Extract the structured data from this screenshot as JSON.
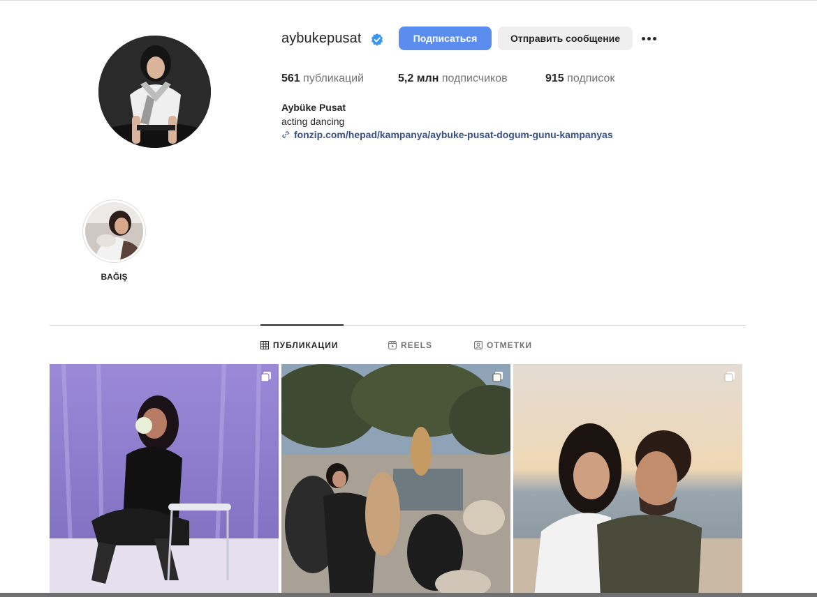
{
  "profile": {
    "username": "aybukepusat",
    "verified_icon": "verified-badge-icon",
    "follow_label": "Подписаться",
    "message_label": "Отправить сообщение",
    "more_icon": "more-options-icon"
  },
  "stats": {
    "posts": {
      "value": "561",
      "label": "публикаций"
    },
    "followers": {
      "value": "5,2 млн",
      "label": "подписчиков"
    },
    "following": {
      "value": "915",
      "label": "подписок"
    }
  },
  "bio": {
    "full_name": "Aybüke Pusat",
    "text": "acting dancing",
    "link": "fonzip.com/hepad/kampanya/aybuke-pusat-dogum-gunu-kampanyas"
  },
  "highlights": [
    {
      "label": "BAĞIŞ"
    }
  ],
  "tabs": [
    {
      "label": "ПУБЛИКАЦИИ",
      "icon": "grid-icon",
      "active": true
    },
    {
      "label": "REELS",
      "icon": "reels-icon",
      "active": false
    },
    {
      "label": "ОТМЕТКИ",
      "icon": "tagged-icon",
      "active": false
    }
  ],
  "colors": {
    "accent": "#5b8def",
    "link": "#385185",
    "muted": "#737373",
    "divider": "#dbdbdb"
  }
}
